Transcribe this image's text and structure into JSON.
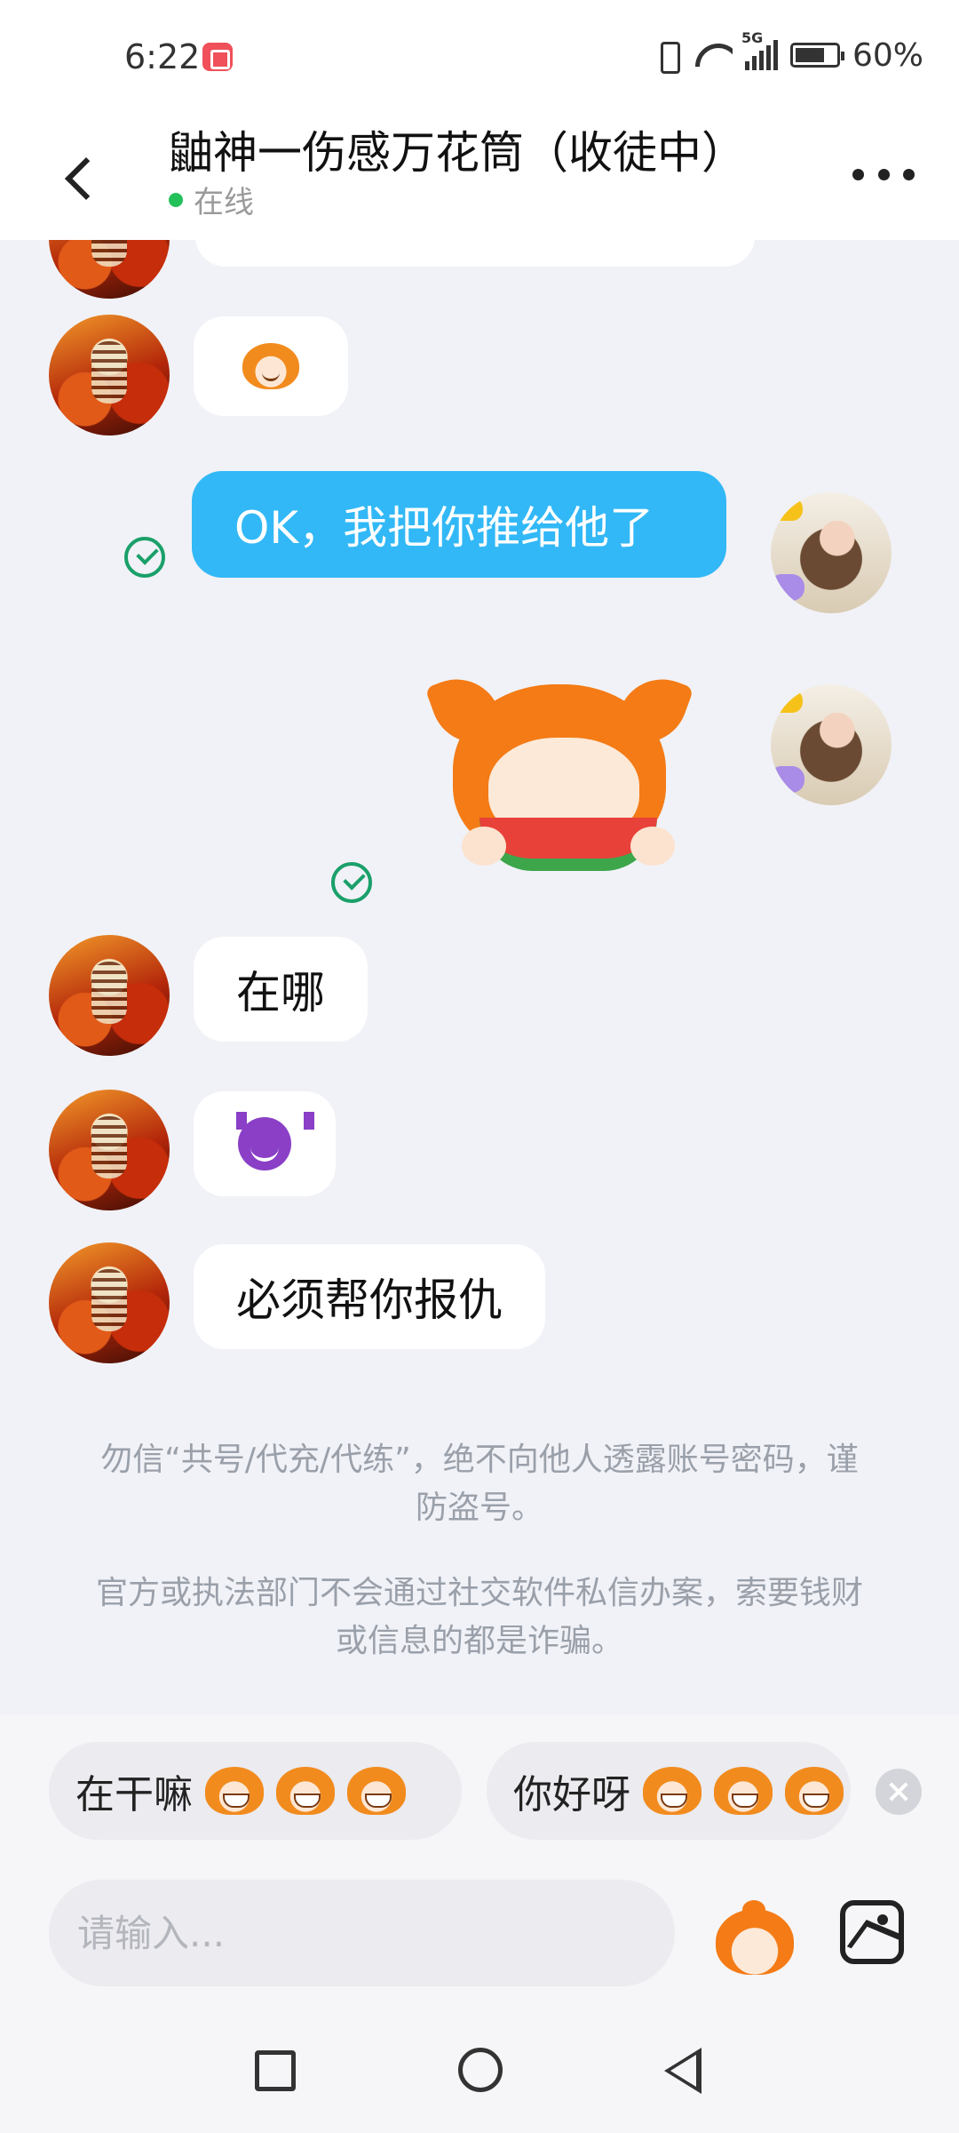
{
  "status_bar": {
    "time": "6:22",
    "network": "5G",
    "battery": "60%"
  },
  "header": {
    "title": "鼬神一伤感万花筒（收徒中）",
    "status": "在线"
  },
  "messages": [
    {
      "from": "friend",
      "type": "emoji",
      "icon": "mascot-face-emoji"
    },
    {
      "from": "me",
      "type": "text",
      "text": "OK，我把你推给他了",
      "read": true
    },
    {
      "from": "me",
      "type": "sticker",
      "icon": "mascot-eating-watermelon-sticker",
      "read": true
    },
    {
      "from": "friend",
      "type": "text",
      "text": "在哪"
    },
    {
      "from": "friend",
      "type": "emoji",
      "icon": "smiling-devil-emoji"
    },
    {
      "from": "friend",
      "type": "text",
      "text": "必须帮你报仇"
    }
  ],
  "notices": [
    "勿信“共号/代充/代练”，绝不向他人透露账号密码，谨防盗号。",
    "官方或执法部门不会通过社交软件私信办案，索要钱财或信息的都是诈骗。"
  ],
  "quick_replies": [
    {
      "label": "在干嘛",
      "emoji": "grinning-mascot-emoji"
    },
    {
      "label": "你好呀",
      "emoji": "wide-eyed-mascot-emoji"
    }
  ],
  "input": {
    "placeholder": "请输入..."
  },
  "colors": {
    "accent": "#32b8f6",
    "online": "#23c15a",
    "read_check": "#1aa06a",
    "chat_bg": "#f1f2f7"
  }
}
